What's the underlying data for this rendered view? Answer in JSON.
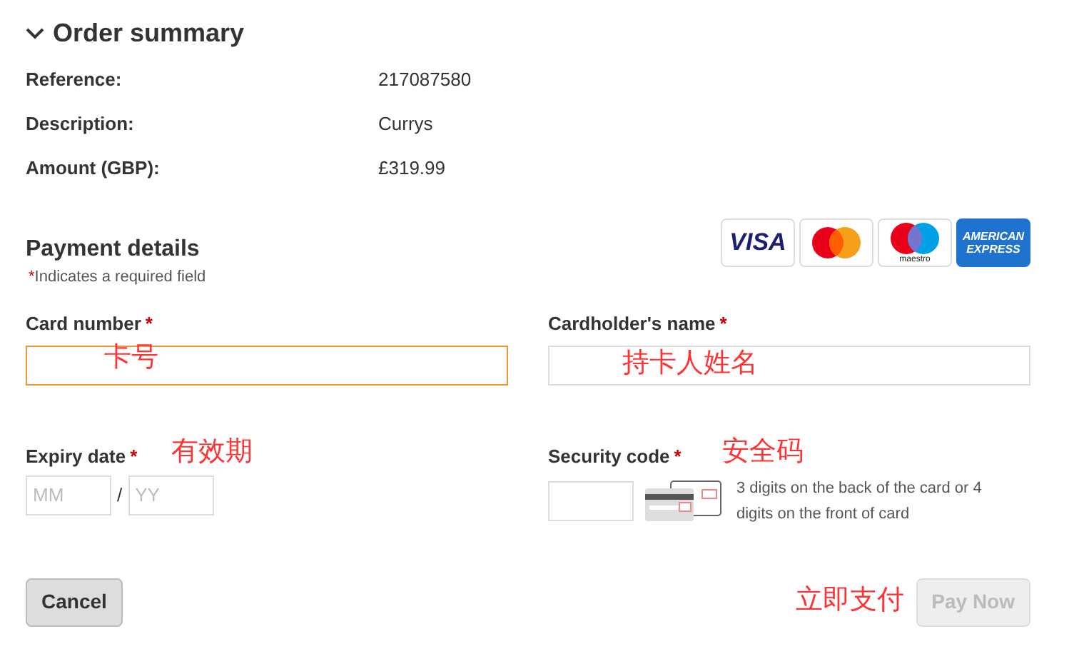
{
  "order_summary": {
    "title": "Order summary",
    "expanded": true,
    "rows": [
      {
        "label": "Reference:",
        "value": "217087580"
      },
      {
        "label": "Description:",
        "value": "Currys"
      },
      {
        "label": "Amount (GBP):",
        "value": "£319.99"
      }
    ]
  },
  "payment": {
    "title": "Payment details",
    "required_mark": "*",
    "required_note": "Indicates a required field",
    "card_logos": [
      {
        "kind": "visa",
        "text": "VISA"
      },
      {
        "kind": "mastercard"
      },
      {
        "kind": "maestro",
        "text": "maestro"
      },
      {
        "kind": "amex",
        "text": "AMERICAN EXPRESS"
      }
    ],
    "fields": [
      {
        "kind": "text",
        "label": "Card number",
        "required": true,
        "focused": true,
        "annotation": "卡号"
      },
      {
        "kind": "text",
        "label": "Cardholder's name",
        "required": true,
        "focused": false,
        "annotation": "持卡人姓名"
      },
      {
        "kind": "expiry",
        "label": "Expiry date",
        "required": true,
        "annotation": "有效期",
        "month_placeholder": "MM",
        "separator": "/",
        "year_placeholder": "YY"
      },
      {
        "kind": "cvv",
        "label": "Security code",
        "required": true,
        "annotation": "安全码",
        "hint": "3 digits on the back of the card or 4 digits on the front of card"
      }
    ]
  },
  "buttons": [
    {
      "label": "Cancel",
      "disabled": false
    },
    {
      "label": "Pay Now",
      "disabled": true,
      "annotation": "立即支付"
    }
  ]
}
